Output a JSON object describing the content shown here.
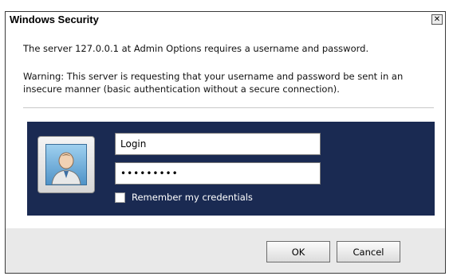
{
  "window": {
    "title": "Windows Security",
    "close_glyph": "✕"
  },
  "message": {
    "line1": "The server 127.0.0.1 at Admin Options requires a username and password.",
    "line2": "Warning: This server is requesting that your username and password be sent in an insecure manner (basic authentication without a secure connection)."
  },
  "credentials": {
    "icon": "user-avatar-icon",
    "username_value": "Login",
    "password_value": "•••••••••",
    "remember_label": "Remember my credentials",
    "remember_checked": false
  },
  "buttons": {
    "ok_label": "OK",
    "cancel_label": "Cancel"
  },
  "colors": {
    "panel_bg": "#1a2a52",
    "footer_bg": "#e9e9e9"
  }
}
